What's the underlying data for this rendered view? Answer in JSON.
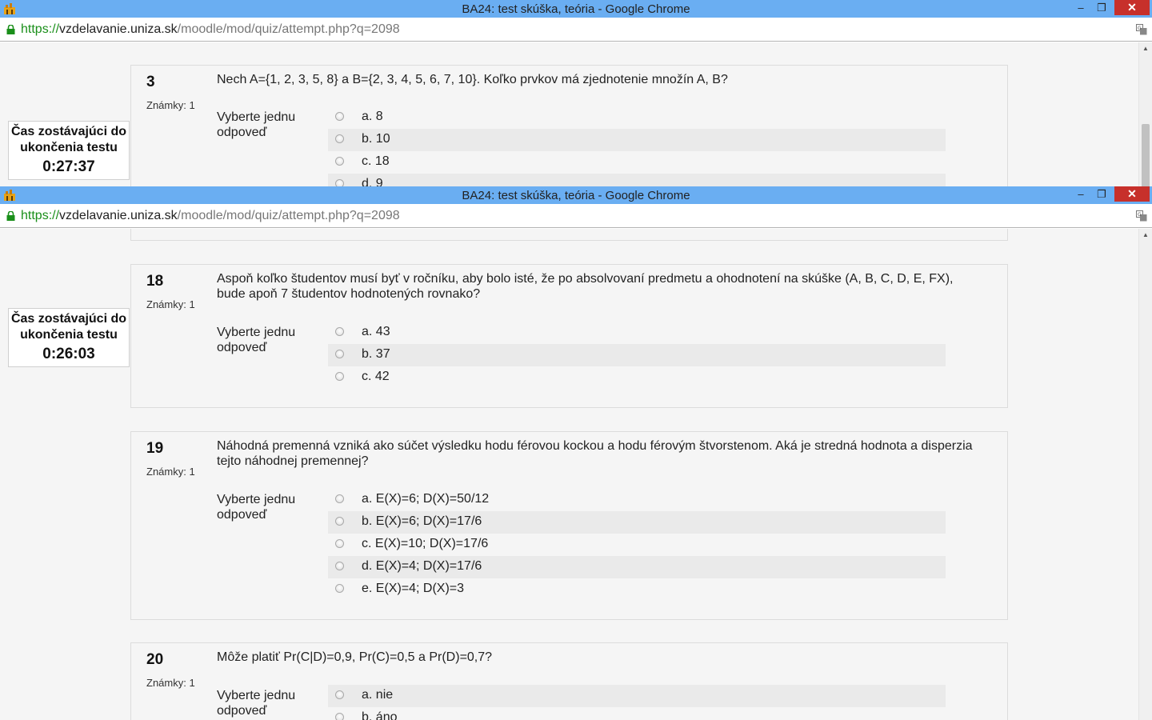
{
  "window_top": {
    "title": "BA24: test skúška, teória - Google Chrome",
    "url_scheme": "https://",
    "url_host": "vzdelavanie.uniza.sk",
    "url_path": "/moodle/mod/quiz/attempt.php?q=2098",
    "min_label": "‒",
    "max_label": "❐",
    "close_label": "✕",
    "timer": {
      "label_line1": "Čas zostávajúci do",
      "label_line2": "ukončenia testu",
      "value": "0:27:37"
    },
    "question": {
      "number": "3",
      "marks": "Známky: 1",
      "text": "Nech A={1, 2, 3, 5, 8} a B={2, 3, 4, 5, 6, 7, 10}. Koľko prvkov má zjednotenie množín A, B?",
      "prompt_line1": "Vyberte jednu",
      "prompt_line2": "odpoveď",
      "answers": [
        "a. 8",
        "b. 10",
        "c. 18",
        "d. 9"
      ]
    }
  },
  "window_bottom": {
    "title": "BA24: test skúška, teória - Google Chrome",
    "url_scheme": "https://",
    "url_host": "vzdelavanie.uniza.sk",
    "url_path": "/moodle/mod/quiz/attempt.php?q=2098",
    "min_label": "‒",
    "max_label": "❐",
    "close_label": "✕",
    "timer": {
      "label_line1": "Čas zostávajúci do",
      "label_line2": "ukončenia testu",
      "value": "0:26:03"
    },
    "questions": [
      {
        "number": "18",
        "marks": "Známky: 1",
        "text": "Aspoň koľko študentov musí byť v ročníku, aby bolo isté, že po absolvovaní predmetu a ohodnotení na skúške (A, B, C, D, E, FX), bude apoň 7 študentov hodnotených rovnako?",
        "prompt_line1": "Vyberte jednu",
        "prompt_line2": "odpoveď",
        "answers": [
          "a. 43",
          "b. 37",
          "c. 42"
        ]
      },
      {
        "number": "19",
        "marks": "Známky: 1",
        "text": "Náhodná premenná vzniká ako súčet výsledku hodu férovou kockou a hodu férovým štvorstenom. Aká je stredná hodnota a disperzia tejto náhodnej premennej?",
        "prompt_line1": "Vyberte jednu",
        "prompt_line2": "odpoveď",
        "answers": [
          "a. E(X)=6; D(X)=50/12",
          "b. E(X)=6; D(X)=17/6",
          "c. E(X)=10; D(X)=17/6",
          "d. E(X)=4; D(X)=17/6",
          "e. E(X)=4; D(X)=3"
        ]
      },
      {
        "number": "20",
        "marks": "Známky: 1",
        "text": "Môže platiť Pr(C|D)=0,9, Pr(C)=0,5 a Pr(D)=0,7?",
        "prompt_line1": "Vyberte jednu",
        "prompt_line2": "odpoveď",
        "answers": [
          "a. nie",
          "b. áno"
        ]
      }
    ]
  },
  "colors": {
    "titlebar": "#6aaef2",
    "close": "#c7302b",
    "url_scheme": "#1a8f1a"
  }
}
